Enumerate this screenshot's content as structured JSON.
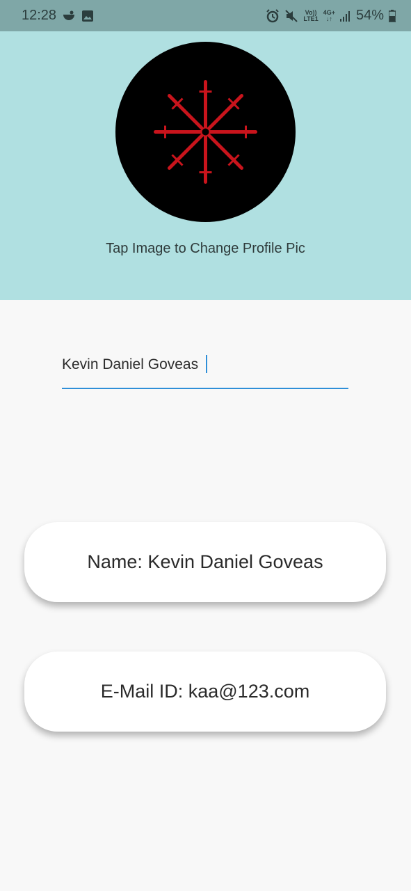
{
  "status": {
    "time": "12:28",
    "network_top": "Vo))",
    "network_bottom": "LTE1",
    "data_top": "4G+",
    "data_bottom": "↓↑",
    "battery": "54%"
  },
  "profile": {
    "hint": "Tap Image to Change Profile Pic",
    "name_value": "Kevin Daniel Goveas"
  },
  "cards": {
    "name": "Name: Kevin Daniel Goveas",
    "email": "E-Mail ID: kaa@123.com"
  },
  "colors": {
    "header_bg": "#b0e0e1",
    "status_bg": "#7fa7a7",
    "accent": "#2f8fd8",
    "symbol": "#c9141c"
  }
}
